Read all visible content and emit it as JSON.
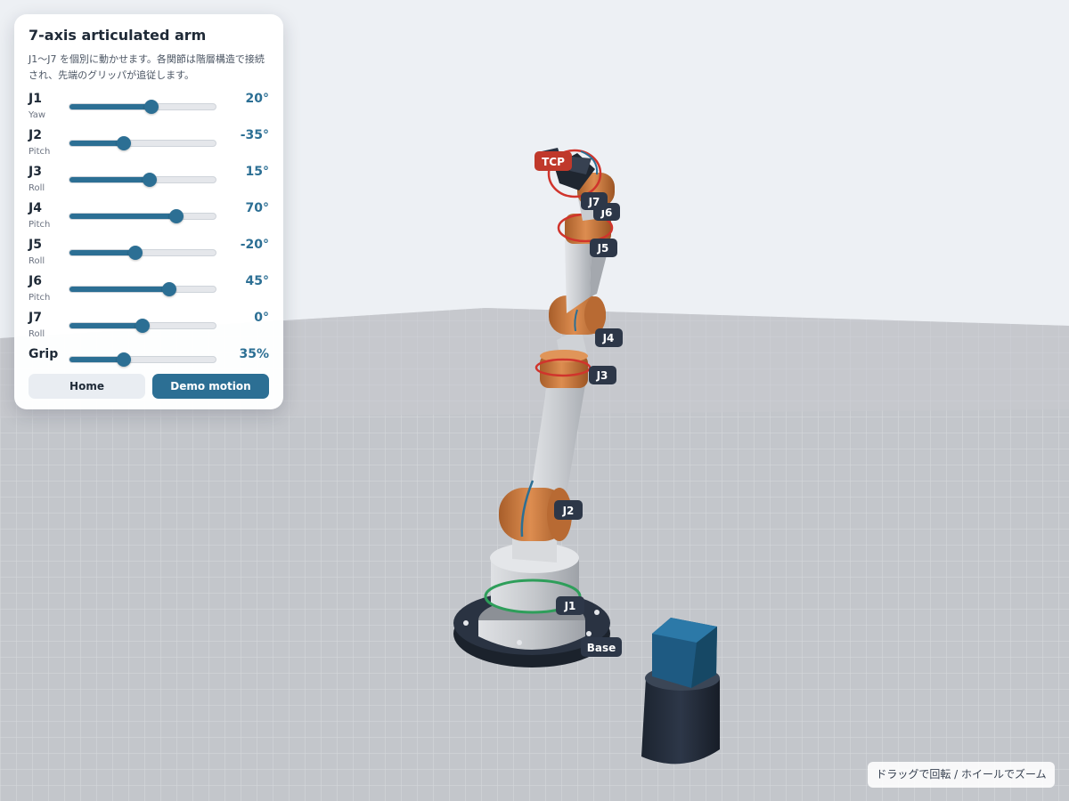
{
  "panel": {
    "title": "7-axis articulated arm",
    "description": "J1〜J7 を個別に動かせます。各関節は階層構造で接続され、先端のグリッパが追従します。",
    "joints": [
      {
        "name": "J1",
        "type": "Yaw",
        "value_label": "20°",
        "level": 0.56
      },
      {
        "name": "J2",
        "type": "Pitch",
        "value_label": "-35°",
        "level": 0.37
      },
      {
        "name": "J3",
        "type": "Roll",
        "value_label": "15°",
        "level": 0.55
      },
      {
        "name": "J4",
        "type": "Pitch",
        "value_label": "70°",
        "level": 0.73
      },
      {
        "name": "J5",
        "type": "Roll",
        "value_label": "-20°",
        "level": 0.45
      },
      {
        "name": "J6",
        "type": "Pitch",
        "value_label": "45°",
        "level": 0.68
      },
      {
        "name": "J7",
        "type": "Roll",
        "value_label": "0°",
        "level": 0.5
      }
    ],
    "grip": {
      "name": "Grip",
      "value_label": "35%",
      "level": 0.37
    },
    "home_label": "Home",
    "demo_label": "Demo motion"
  },
  "scene": {
    "labels": {
      "tcp": "TCP",
      "j7": "J7",
      "j6": "J6",
      "j5": "J5",
      "j4": "J4",
      "j3": "J3",
      "j2": "J2",
      "j1": "J1",
      "base": "Base"
    }
  },
  "hint": "ドラッグで回転 / ホイールでズーム",
  "colors": {
    "accent": "#2c6f94",
    "joint_copper": "#c97a40",
    "link_gray": "#c9ccd0",
    "base_dark": "#2a3342",
    "tcp_red": "#c0392b",
    "ring_red": "#d0342c",
    "ring_green": "#2e9e5a",
    "cube_blue": "#1e5a82"
  }
}
